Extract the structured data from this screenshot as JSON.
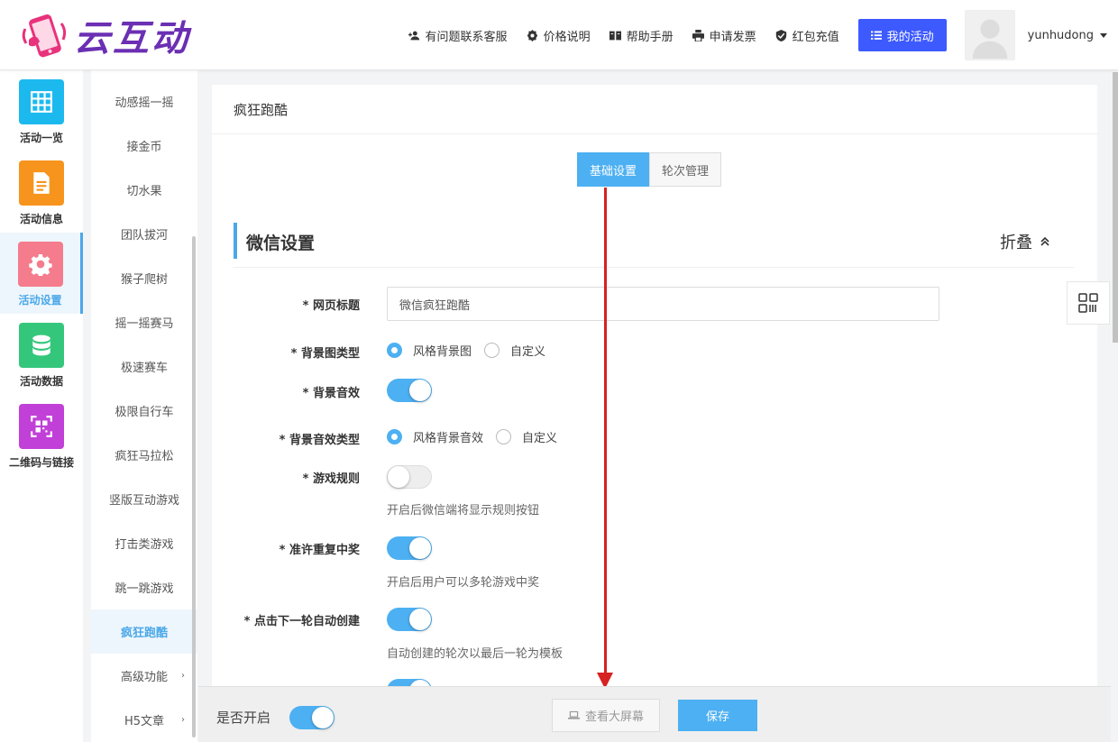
{
  "brand": {
    "name": "云互动"
  },
  "topnav": {
    "links": [
      {
        "label": "有问题联系客服",
        "icon": "user-plus-icon"
      },
      {
        "label": "价格说明",
        "icon": "badge-icon"
      },
      {
        "label": "帮助手册",
        "icon": "book-icon"
      },
      {
        "label": "申请发票",
        "icon": "printer-icon"
      },
      {
        "label": "红包充值",
        "icon": "shield-check-icon"
      }
    ],
    "my_activity": "我的活动",
    "username": "yunhudong"
  },
  "iconbar": {
    "items": [
      {
        "label": "活动一览",
        "icon": "grid-icon",
        "color": "#1cb9ee"
      },
      {
        "label": "活动信息",
        "icon": "document-icon",
        "color": "#f7941d"
      },
      {
        "label": "活动设置",
        "icon": "gear-icon",
        "color": "#f47c8c"
      },
      {
        "label": "活动数据",
        "icon": "database-icon",
        "color": "#34c77b"
      },
      {
        "label": "二维码与链接",
        "icon": "qrcode-icon",
        "color": "#c140d8"
      }
    ],
    "active_index": 2
  },
  "subbar": {
    "items": [
      "动感摇一摇",
      "接金币",
      "切水果",
      "团队拔河",
      "猴子爬树",
      "摇一摇赛马",
      "极速赛车",
      "极限自行车",
      "疯狂马拉松",
      "竖版互动游戏",
      "打击类游戏",
      "跳一跳游戏",
      "疯狂跑酷",
      "高级功能",
      "H5文章"
    ],
    "active": "疯狂跑酷"
  },
  "main": {
    "page_title": "疯狂跑酷",
    "tabs": [
      {
        "label": "基础设置",
        "active": true
      },
      {
        "label": "轮次管理",
        "active": false
      }
    ],
    "section_title": "微信设置",
    "fold_label": "折叠",
    "fields": {
      "page_title_label": "* 网页标题",
      "page_title_value": "微信疯狂跑酷",
      "bg_type_label": "* 背景图类型",
      "bg_type_opt1": "风格背景图",
      "bg_type_opt2": "自定义",
      "bg_sound_label": "* 背景音效",
      "bg_sound_on": true,
      "bg_sound_type_label": "* 背景音效类型",
      "bg_sound_type_opt1": "风格背景音效",
      "bg_sound_type_opt2": "自定义",
      "rules_label": "* 游戏规则",
      "rules_on": false,
      "rules_hint": "开启后微信端将显示规则按钮",
      "repeat_label": "* 准许重复中奖",
      "repeat_on": true,
      "repeat_hint": "开启后用户可以多轮游戏中奖",
      "auto_create_label": "* 点击下一轮自动创建",
      "auto_create_on": true,
      "auto_create_hint": "自动创建的轮次以最后一轮为模板"
    }
  },
  "bottombar": {
    "enable_label": "是否开启",
    "enable_on": true,
    "view_screen": "查看大屏幕",
    "save": "保存"
  },
  "colors": {
    "accent": "#4db0f2",
    "primary_button": "#3d5afe",
    "annotation": "#d62222"
  }
}
